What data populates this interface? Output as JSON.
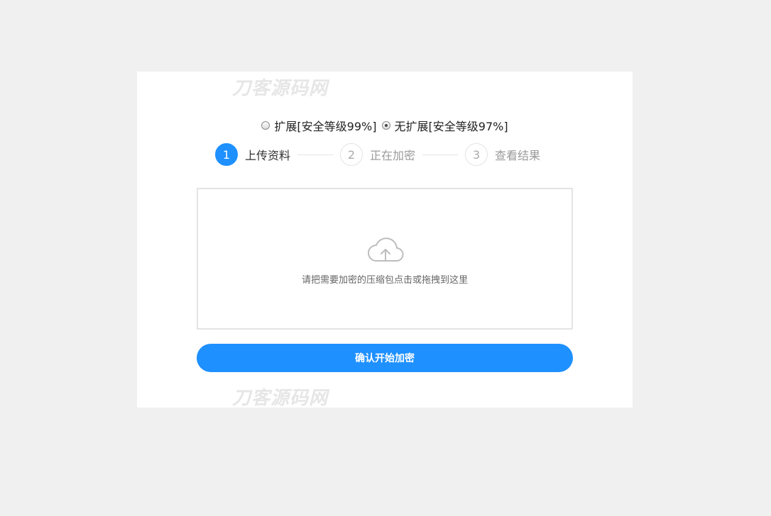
{
  "watermark": {
    "text": "刀客源码网"
  },
  "mode_options": [
    {
      "label": "扩展[安全等级99%]",
      "checked": false
    },
    {
      "label": "无扩展[安全等级97%]",
      "checked": true
    }
  ],
  "steps": [
    {
      "number": "1",
      "label": "上传资料",
      "active": true
    },
    {
      "number": "2",
      "label": "正在加密",
      "active": false
    },
    {
      "number": "3",
      "label": "查看结果",
      "active": false
    }
  ],
  "dropzone": {
    "icon": "cloud-upload-icon",
    "text": "请把需要加密的压缩包点击或拖拽到这里"
  },
  "submit": {
    "label": "确认开始加密"
  },
  "colors": {
    "accent": "#1e90ff",
    "background": "#f0f0f0",
    "card": "#ffffff"
  }
}
